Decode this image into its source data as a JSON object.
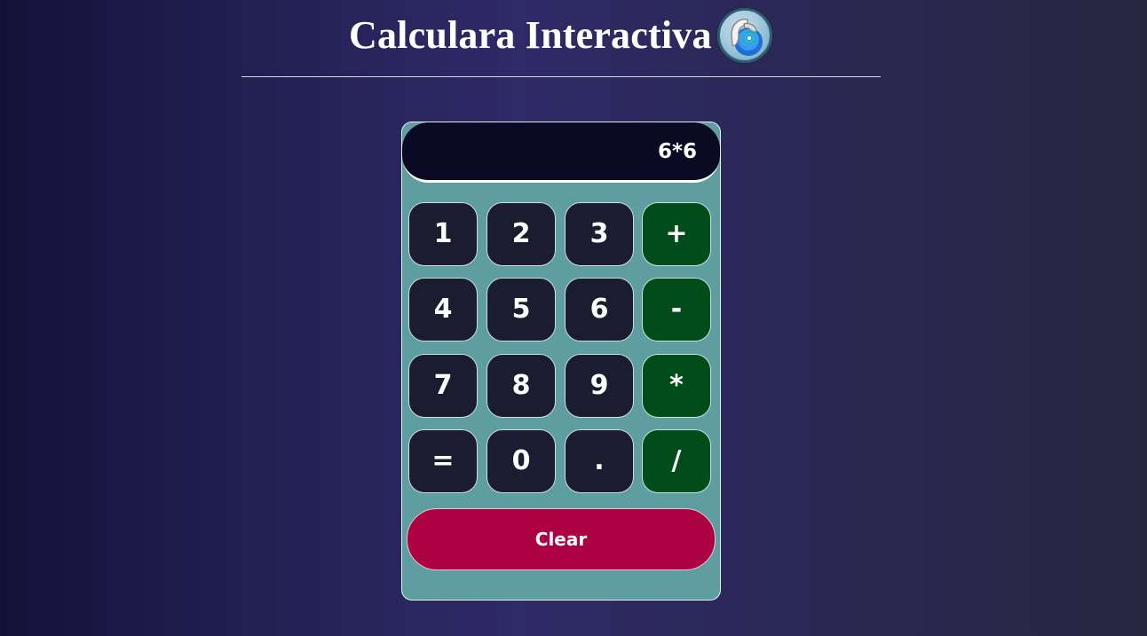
{
  "header": {
    "title": "Calculara Interactiva",
    "logo_icon": "ceramic-disc-logo-icon"
  },
  "calculator": {
    "display": "6*6",
    "keys": [
      {
        "label": "1",
        "kind": "digit"
      },
      {
        "label": "2",
        "kind": "digit"
      },
      {
        "label": "3",
        "kind": "digit"
      },
      {
        "label": "+",
        "kind": "operator"
      },
      {
        "label": "4",
        "kind": "digit"
      },
      {
        "label": "5",
        "kind": "digit"
      },
      {
        "label": "6",
        "kind": "digit"
      },
      {
        "label": "-",
        "kind": "operator"
      },
      {
        "label": "7",
        "kind": "digit"
      },
      {
        "label": "8",
        "kind": "digit"
      },
      {
        "label": "9",
        "kind": "digit"
      },
      {
        "label": "*",
        "kind": "operator"
      },
      {
        "label": "=",
        "kind": "equals"
      },
      {
        "label": "0",
        "kind": "digit"
      },
      {
        "label": ".",
        "kind": "decimal"
      },
      {
        "label": "/",
        "kind": "operator"
      }
    ],
    "clear_label": "Clear"
  },
  "colors": {
    "background": "#2f2a68",
    "panel": "#5f9ea0",
    "display": "#0a0a25",
    "key": "#1c1c30",
    "operator_key": "#004d1a",
    "clear": "#ac0244"
  }
}
